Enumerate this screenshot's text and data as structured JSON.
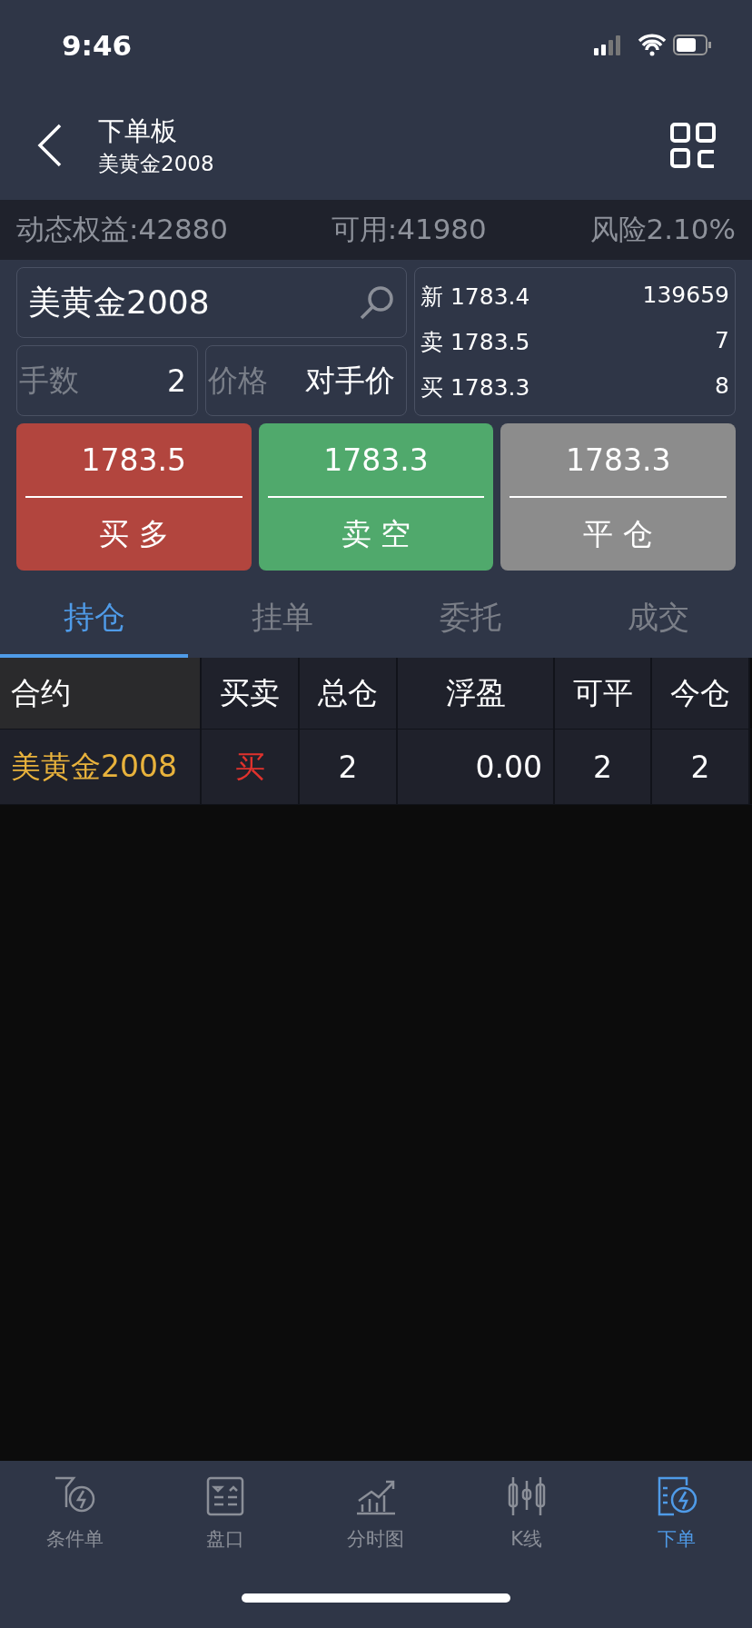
{
  "status_bar": {
    "time": "9:46"
  },
  "header": {
    "title": "下单板",
    "subtitle": "美黄金2008"
  },
  "account": {
    "equity": "动态权益:42880",
    "available": "可用:41980",
    "risk": "风险2.10%"
  },
  "order_form": {
    "symbol": "美黄金2008",
    "lots_label": "手数",
    "lots": "2",
    "price_label": "价格",
    "price": "对手价"
  },
  "quote": [
    {
      "label": "新",
      "price": "1783.4",
      "volume": "139659"
    },
    {
      "label": "卖",
      "price": "1783.5",
      "volume": "7"
    },
    {
      "label": "买",
      "price": "1783.3",
      "volume": "8"
    }
  ],
  "actions": [
    {
      "kind": "buy",
      "price": "1783.5",
      "label": "买 多"
    },
    {
      "kind": "sell",
      "price": "1783.3",
      "label": "卖 空"
    },
    {
      "kind": "close",
      "price": "1783.3",
      "label": "平 仓"
    }
  ],
  "tabs": [
    {
      "label": "持仓",
      "selected": true
    },
    {
      "label": "挂单",
      "selected": false
    },
    {
      "label": "委托",
      "selected": false
    },
    {
      "label": "成交",
      "selected": false
    }
  ],
  "table": {
    "columns": [
      "合约",
      "买卖",
      "总仓",
      "浮盈",
      "可平",
      "今仓"
    ],
    "rows": [
      {
        "color": "#e0322d",
        "cells": [
          "美黄金2008",
          "买",
          "2",
          "0.00",
          "2",
          "2"
        ]
      }
    ]
  },
  "bottom_nav": [
    {
      "kind": "condition",
      "label": "条件单",
      "selected": false
    },
    {
      "kind": "book",
      "label": "盘口",
      "selected": false
    },
    {
      "kind": "timechart",
      "label": "分时图",
      "selected": false
    },
    {
      "kind": "kline",
      "label": "K线",
      "selected": false
    },
    {
      "kind": "order",
      "label": "下单",
      "selected": true
    }
  ]
}
